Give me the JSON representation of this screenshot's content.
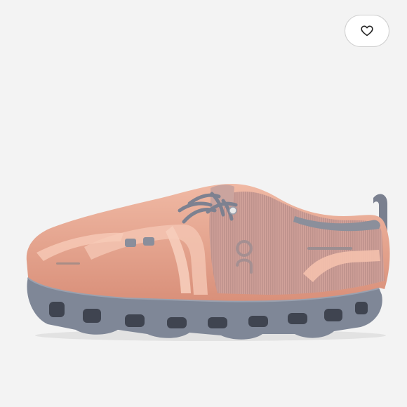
{
  "product": {
    "brand_logo": "on",
    "image_icon": "shoe-image",
    "colors": {
      "upper": "#e6ab96",
      "upper_shadow": "#d8937e",
      "mesh_panel": "#c99d98",
      "sole": "#7f8797",
      "sole_dark": "#5d6473",
      "laces": "#7d8190",
      "background": "#f3f3f3"
    }
  },
  "favorite": {
    "icon": "heart-icon",
    "active": false
  }
}
